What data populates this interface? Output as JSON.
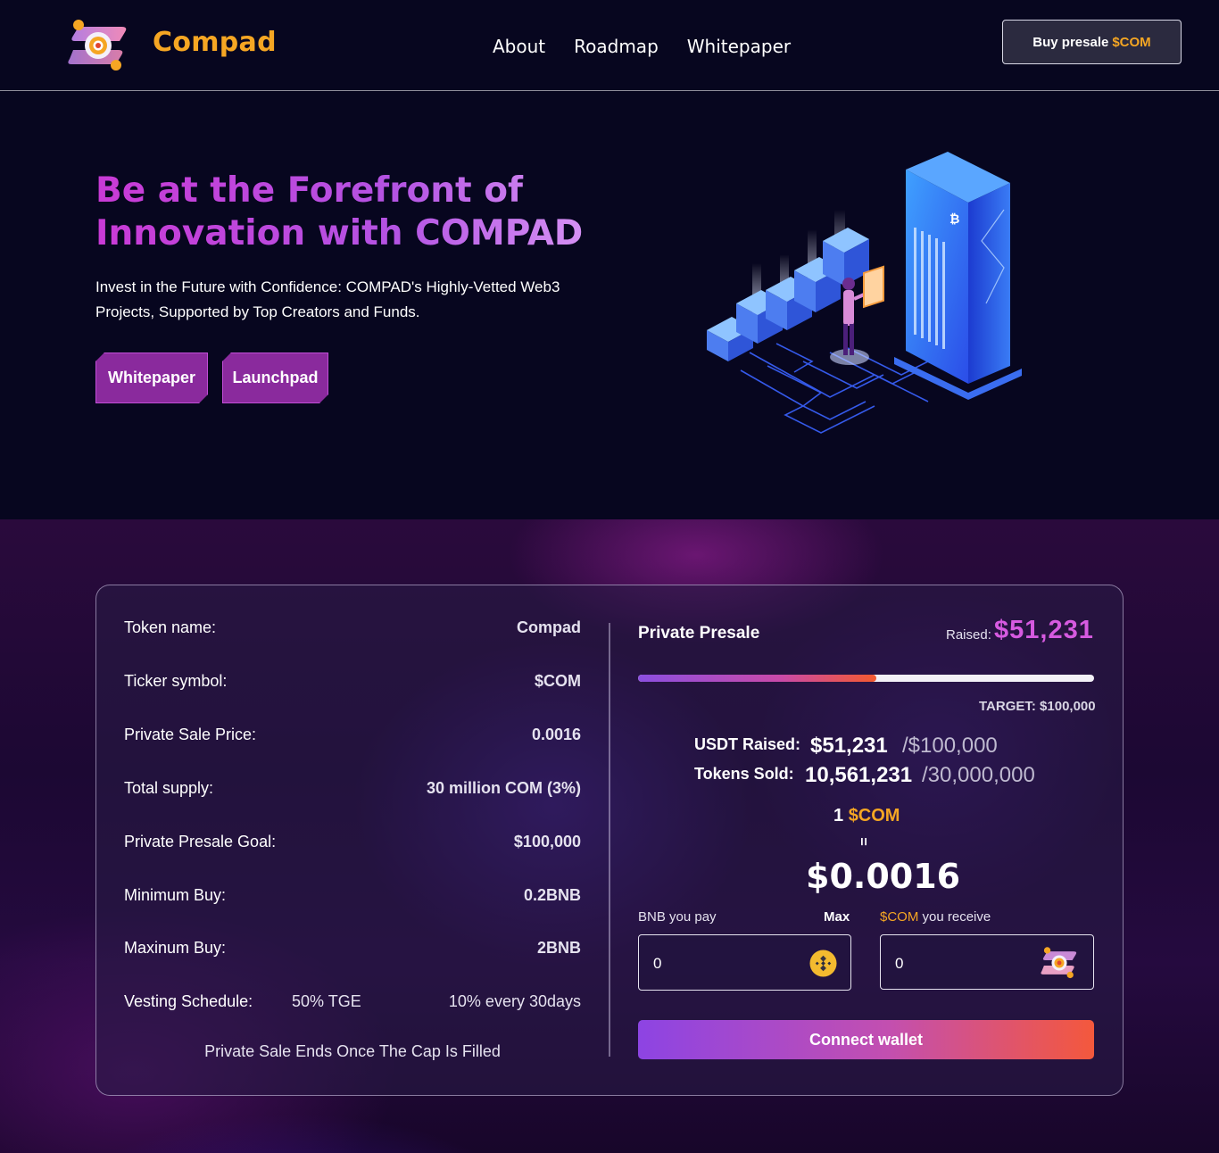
{
  "nav": {
    "brand": "Compad",
    "links": [
      "About",
      "Roadmap",
      "Whitepaper"
    ],
    "buy_button": {
      "prefix": "Buy presale",
      "ticker": "$COM"
    }
  },
  "hero": {
    "title": "Be at the Forefront of Innovation with COMPAD",
    "subtitle": "Invest in the Future with Confidence: COMPAD's Highly-Vetted Web3 Projects, Supported by Top Creators and Funds.",
    "buttons": [
      "Whitepaper",
      "Launchpad"
    ]
  },
  "token_info": {
    "rows": [
      {
        "label": "Token name:",
        "value": "Compad"
      },
      {
        "label": "Ticker symbol:",
        "value": "$COM"
      },
      {
        "label": "Private Sale Price:",
        "value": "0.0016"
      },
      {
        "label": "Total supply:",
        "value": "30 million COM (3%)"
      },
      {
        "label": "Private Presale Goal:",
        "value": "$100,000"
      },
      {
        "label": "Minimum Buy:",
        "value": "0.2BNB"
      },
      {
        "label": "Maxinum Buy:",
        "value": "2BNB"
      }
    ],
    "vesting": {
      "label": "Vesting Schedule:",
      "tge": "50% TGE",
      "schedule": "10% every 30days"
    },
    "note": "Private Sale Ends Once The Cap Is Filled"
  },
  "presale": {
    "title": "Private Presale",
    "raised_label": "Raised:",
    "raised_amount": "$51,231",
    "progress_fraction": 0.523,
    "target": "TARGET: $100,000",
    "usdt_label": "USDT Raised:",
    "usdt_value": "$51,231",
    "usdt_of": "/$100,000",
    "tokens_label": "Tokens Sold:",
    "tokens_value": "10,561,231",
    "tokens_of": "/30,000,000",
    "rate_prefix": "1",
    "rate_ticker": "$COM",
    "equals": "=",
    "price": "$0.0016",
    "pay_label": "BNB you pay",
    "max_label": "Max",
    "receive_ticker": "$COM",
    "receive_label": "you receive",
    "pay_value": "0",
    "receive_value": "0",
    "connect_label": "Connect wallet"
  },
  "colors": {
    "accent_orange": "#f5a623",
    "accent_magenta": "#d65ae0",
    "page_bg": "#07061f"
  }
}
